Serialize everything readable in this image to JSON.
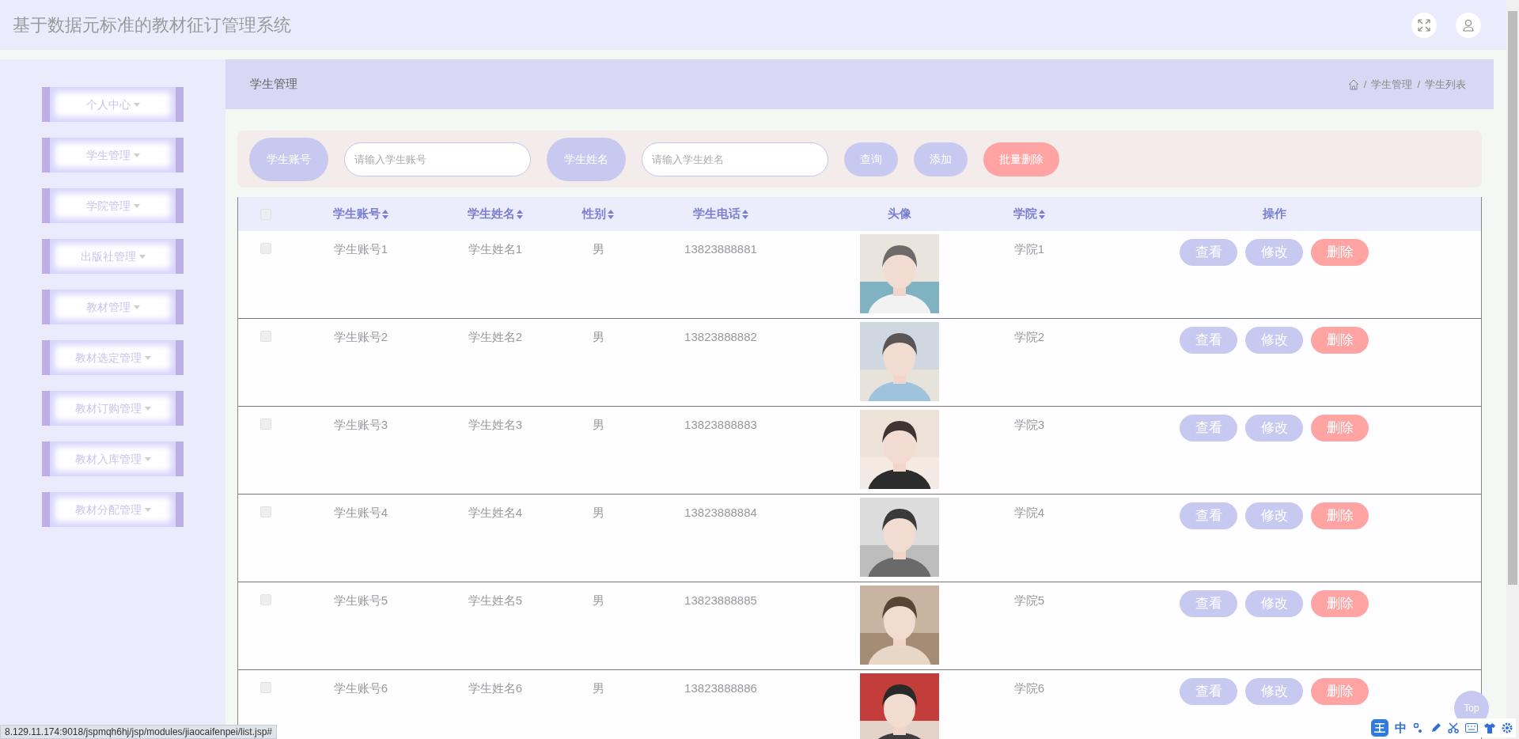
{
  "header": {
    "title": "基于数据元标准的教材征订管理系统"
  },
  "sidebar": {
    "items": [
      {
        "label": "个人中心"
      },
      {
        "label": "学生管理"
      },
      {
        "label": "学院管理"
      },
      {
        "label": "出版社管理"
      },
      {
        "label": "教材管理"
      },
      {
        "label": "教材选定管理"
      },
      {
        "label": "教材订购管理"
      },
      {
        "label": "教材入库管理"
      },
      {
        "label": "教材分配管理"
      }
    ]
  },
  "page_header": {
    "title": "学生管理",
    "breadcrumb": [
      {
        "separator": "/",
        "label": "学生管理"
      },
      {
        "separator": "/",
        "label": "学生列表"
      }
    ]
  },
  "search": {
    "fields": [
      {
        "label": "学生账号",
        "placeholder": "请输入学生账号"
      },
      {
        "label": "学生姓名",
        "placeholder": "请输入学生姓名"
      }
    ],
    "buttons": [
      {
        "label": "查询",
        "kind": "normal"
      },
      {
        "label": "添加",
        "kind": "normal"
      },
      {
        "label": "批量删除",
        "kind": "danger"
      }
    ]
  },
  "table": {
    "select_all": {
      "checked": false
    },
    "columns": [
      {
        "label": "学生账号",
        "sortable": true
      },
      {
        "label": "学生姓名",
        "sortable": true
      },
      {
        "label": "性别",
        "sortable": true
      },
      {
        "label": "学生电话",
        "sortable": true
      },
      {
        "label": "头像",
        "sortable": false
      },
      {
        "label": "学院",
        "sortable": true
      },
      {
        "label": "操作",
        "sortable": false
      }
    ],
    "rows": [
      {
        "checked": false,
        "account": "学生账号1",
        "name": "学生姓名1",
        "gender": "男",
        "phone": "13823888881",
        "college": "学院1",
        "actions": [
          {
            "label": "查看",
            "kind": "normal"
          },
          {
            "label": "修改",
            "kind": "normal"
          },
          {
            "label": "删除",
            "kind": "danger"
          }
        ]
      },
      {
        "checked": false,
        "account": "学生账号2",
        "name": "学生姓名2",
        "gender": "男",
        "phone": "13823888882",
        "college": "学院2",
        "actions": [
          {
            "label": "查看",
            "kind": "normal"
          },
          {
            "label": "修改",
            "kind": "normal"
          },
          {
            "label": "删除",
            "kind": "danger"
          }
        ]
      },
      {
        "checked": false,
        "account": "学生账号3",
        "name": "学生姓名3",
        "gender": "男",
        "phone": "13823888883",
        "college": "学院3",
        "actions": [
          {
            "label": "查看",
            "kind": "normal"
          },
          {
            "label": "修改",
            "kind": "normal"
          },
          {
            "label": "删除",
            "kind": "danger"
          }
        ]
      },
      {
        "checked": false,
        "account": "学生账号4",
        "name": "学生姓名4",
        "gender": "男",
        "phone": "13823888884",
        "college": "学院4",
        "actions": [
          {
            "label": "查看",
            "kind": "normal"
          },
          {
            "label": "修改",
            "kind": "normal"
          },
          {
            "label": "删除",
            "kind": "danger"
          }
        ]
      },
      {
        "checked": false,
        "account": "学生账号5",
        "name": "学生姓名5",
        "gender": "男",
        "phone": "13823888885",
        "college": "学院5",
        "actions": [
          {
            "label": "查看",
            "kind": "normal"
          },
          {
            "label": "修改",
            "kind": "normal"
          },
          {
            "label": "删除",
            "kind": "danger"
          }
        ]
      },
      {
        "checked": false,
        "account": "学生账号6",
        "name": "学生姓名6",
        "gender": "男",
        "phone": "13823888886",
        "college": "学院6",
        "actions": [
          {
            "label": "查看",
            "kind": "normal"
          },
          {
            "label": "修改",
            "kind": "normal"
          },
          {
            "label": "删除",
            "kind": "danger"
          }
        ]
      }
    ]
  },
  "back_to_top": "Top",
  "status_url": "8.129.11.174:9018/jspmqh6hj/jsp/modules/jiaocaifenpei/list.jsp#",
  "ime_toolbar": [
    "王",
    "中"
  ]
}
